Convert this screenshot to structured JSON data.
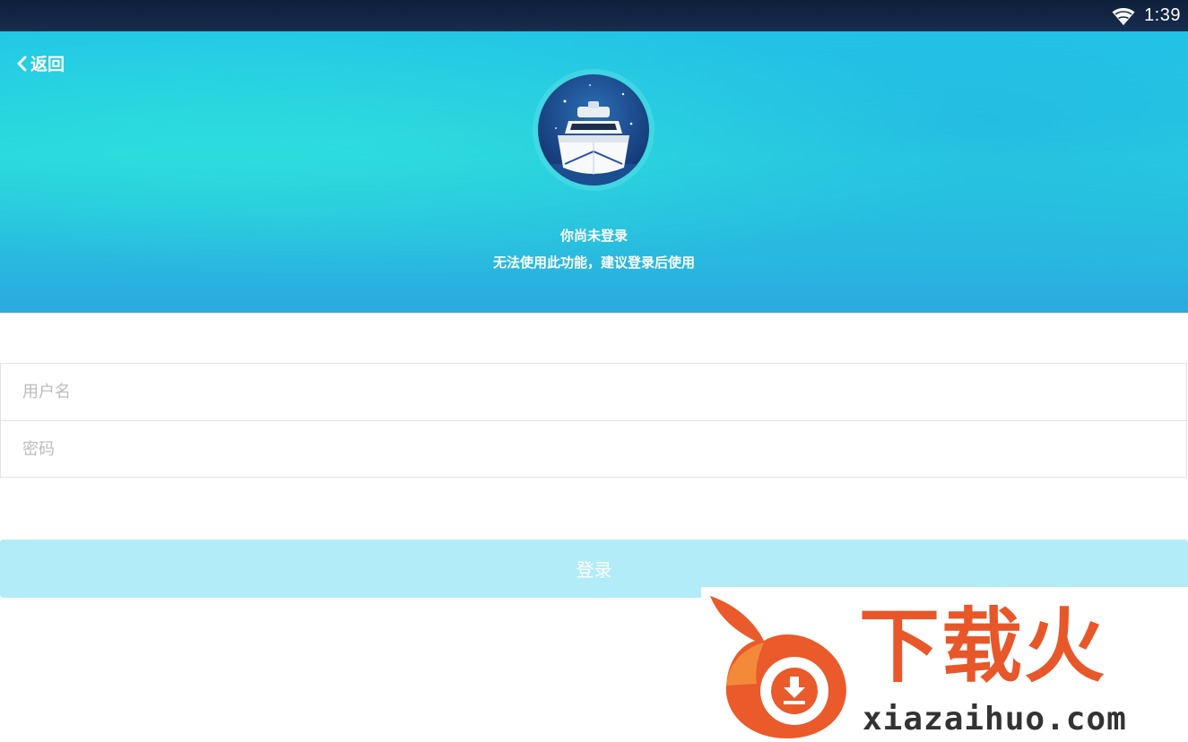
{
  "status_bar": {
    "time": "1:39",
    "wifi_icon": "wifi-icon"
  },
  "header": {
    "back_label": "返回",
    "back_icon": "chevron-left-icon",
    "avatar_icon": "boat-icon",
    "notice_title": "你尚未登录",
    "notice_subtitle": "无法使用此功能，建议登录后使用"
  },
  "form": {
    "username_placeholder": "用户名",
    "username_value": "",
    "password_placeholder": "密码",
    "password_value": ""
  },
  "login_button": {
    "label": "登录"
  },
  "watermark": {
    "brand_text": "下载火",
    "url": "xiazaihuo.com",
    "logo_icon": "flame-download-icon"
  },
  "colors": {
    "header_start": "#22c7e6",
    "header_end": "#2aa9e0",
    "login_button": "#b2ecf8",
    "watermark_brand": "#e8572a"
  }
}
